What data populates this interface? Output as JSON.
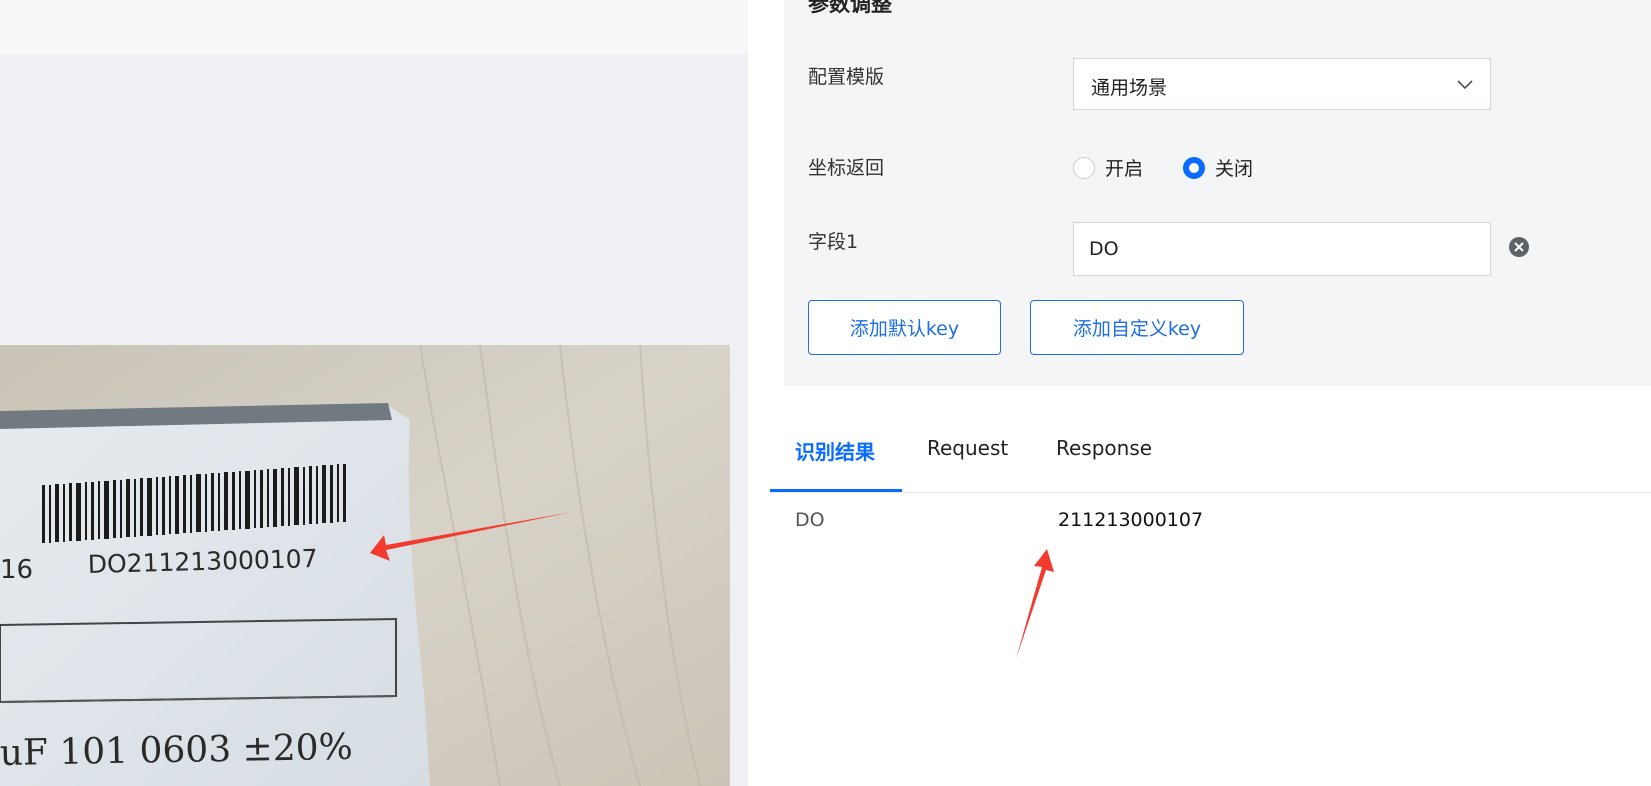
{
  "params": {
    "title": "参数调整",
    "template_label": "配置模版",
    "template_value": "通用场景",
    "coord_label": "坐标返回",
    "radio_on": "开启",
    "radio_off": "关闭",
    "radio_selected": "关闭",
    "field1_label": "字段1",
    "field1_value": "DO",
    "add_default_key": "添加默认key",
    "add_custom_key": "添加自定义key"
  },
  "tabs": {
    "items": [
      "识别结果",
      "Request",
      "Response"
    ],
    "active": "识别结果"
  },
  "result": {
    "key": "DO",
    "value": "211213000107"
  },
  "photo": {
    "label_left": "16",
    "barcode_text": "DO211213000107",
    "bottom_text": "uF 101 0603 ±20%"
  },
  "colors": {
    "accent": "#0a6cff",
    "button_border": "#1f6fe0",
    "annotation_arrow": "#f23a2e",
    "panel_bg": "#f4f5f7",
    "left_bg": "#eef0f4"
  }
}
